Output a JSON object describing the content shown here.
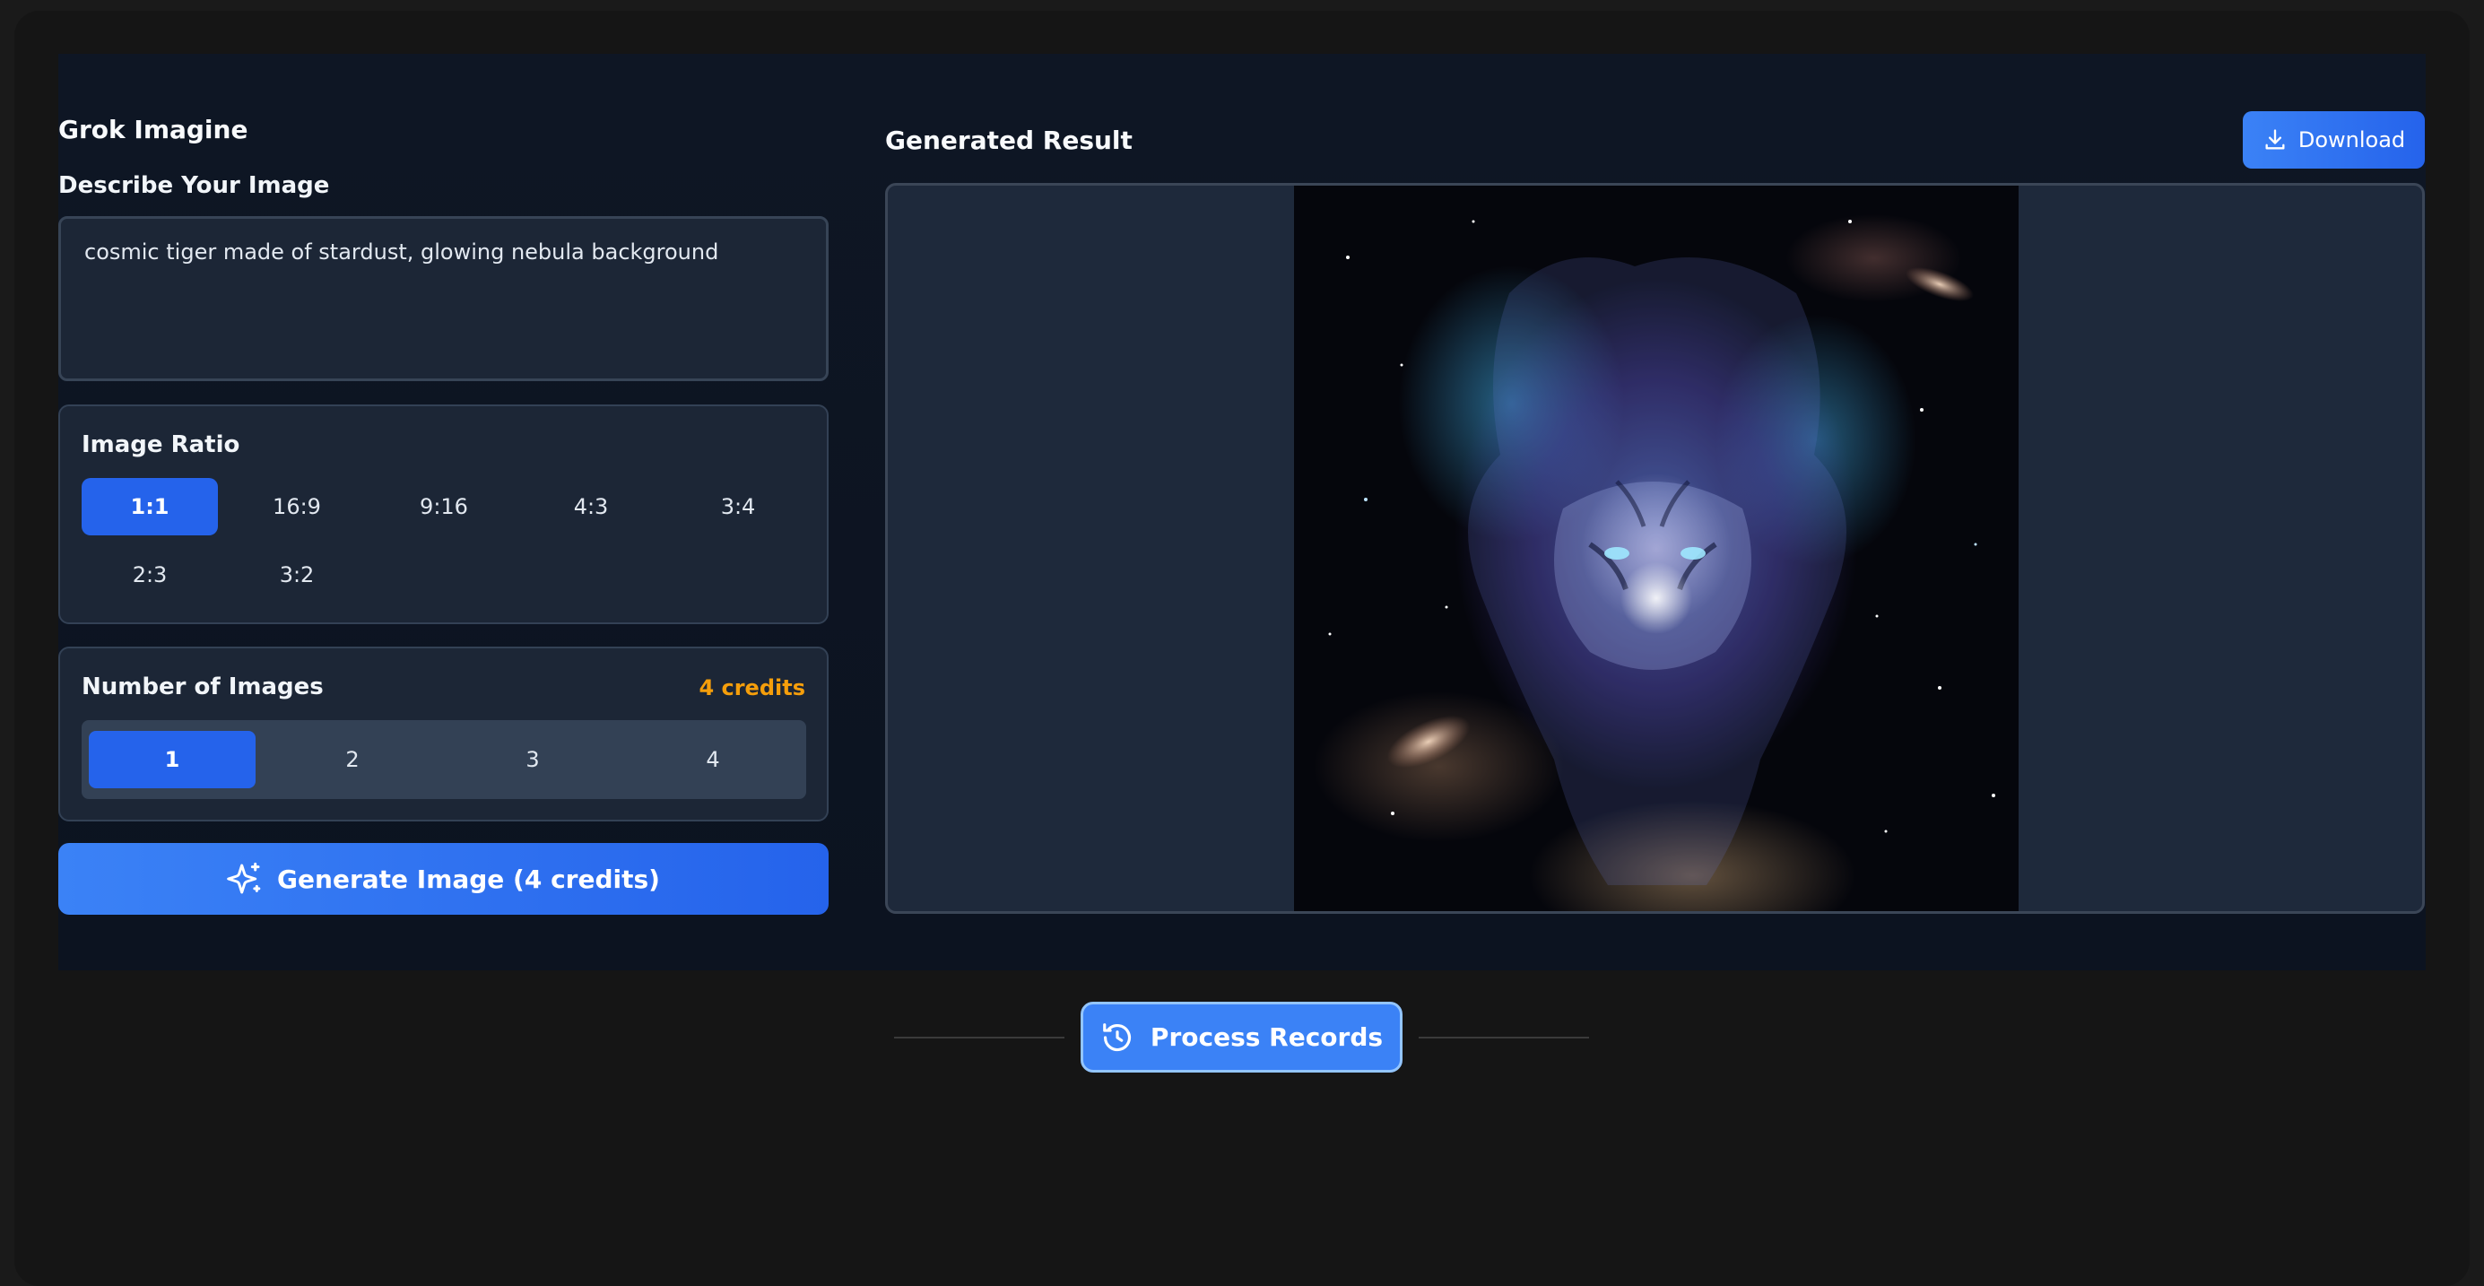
{
  "app": {
    "title": "Grok Imagine"
  },
  "prompt": {
    "label": "Describe Your Image",
    "value": "cosmic tiger made of stardust, glowing nebula background"
  },
  "ratio": {
    "label": "Image Ratio",
    "selected": "1:1",
    "options": [
      "1:1",
      "16:9",
      "9:16",
      "4:3",
      "3:4",
      "2:3",
      "3:2"
    ]
  },
  "count": {
    "label": "Number of Images",
    "credits": "4 credits",
    "selected": "1",
    "options": [
      "1",
      "2",
      "3",
      "4"
    ]
  },
  "generate": {
    "label": "Generate Image (4 credits)",
    "icon": "sparkles-icon"
  },
  "result": {
    "title": "Generated Result",
    "download_label": "Download",
    "download_icon": "download-icon"
  },
  "records": {
    "label": "Process Records",
    "icon": "history-icon"
  },
  "colors": {
    "accent": "#2563eb",
    "accent_light": "#3b82f6",
    "credits": "#f59e0b",
    "panel_bg": "#0e1624",
    "card_bg": "#1c2636"
  }
}
